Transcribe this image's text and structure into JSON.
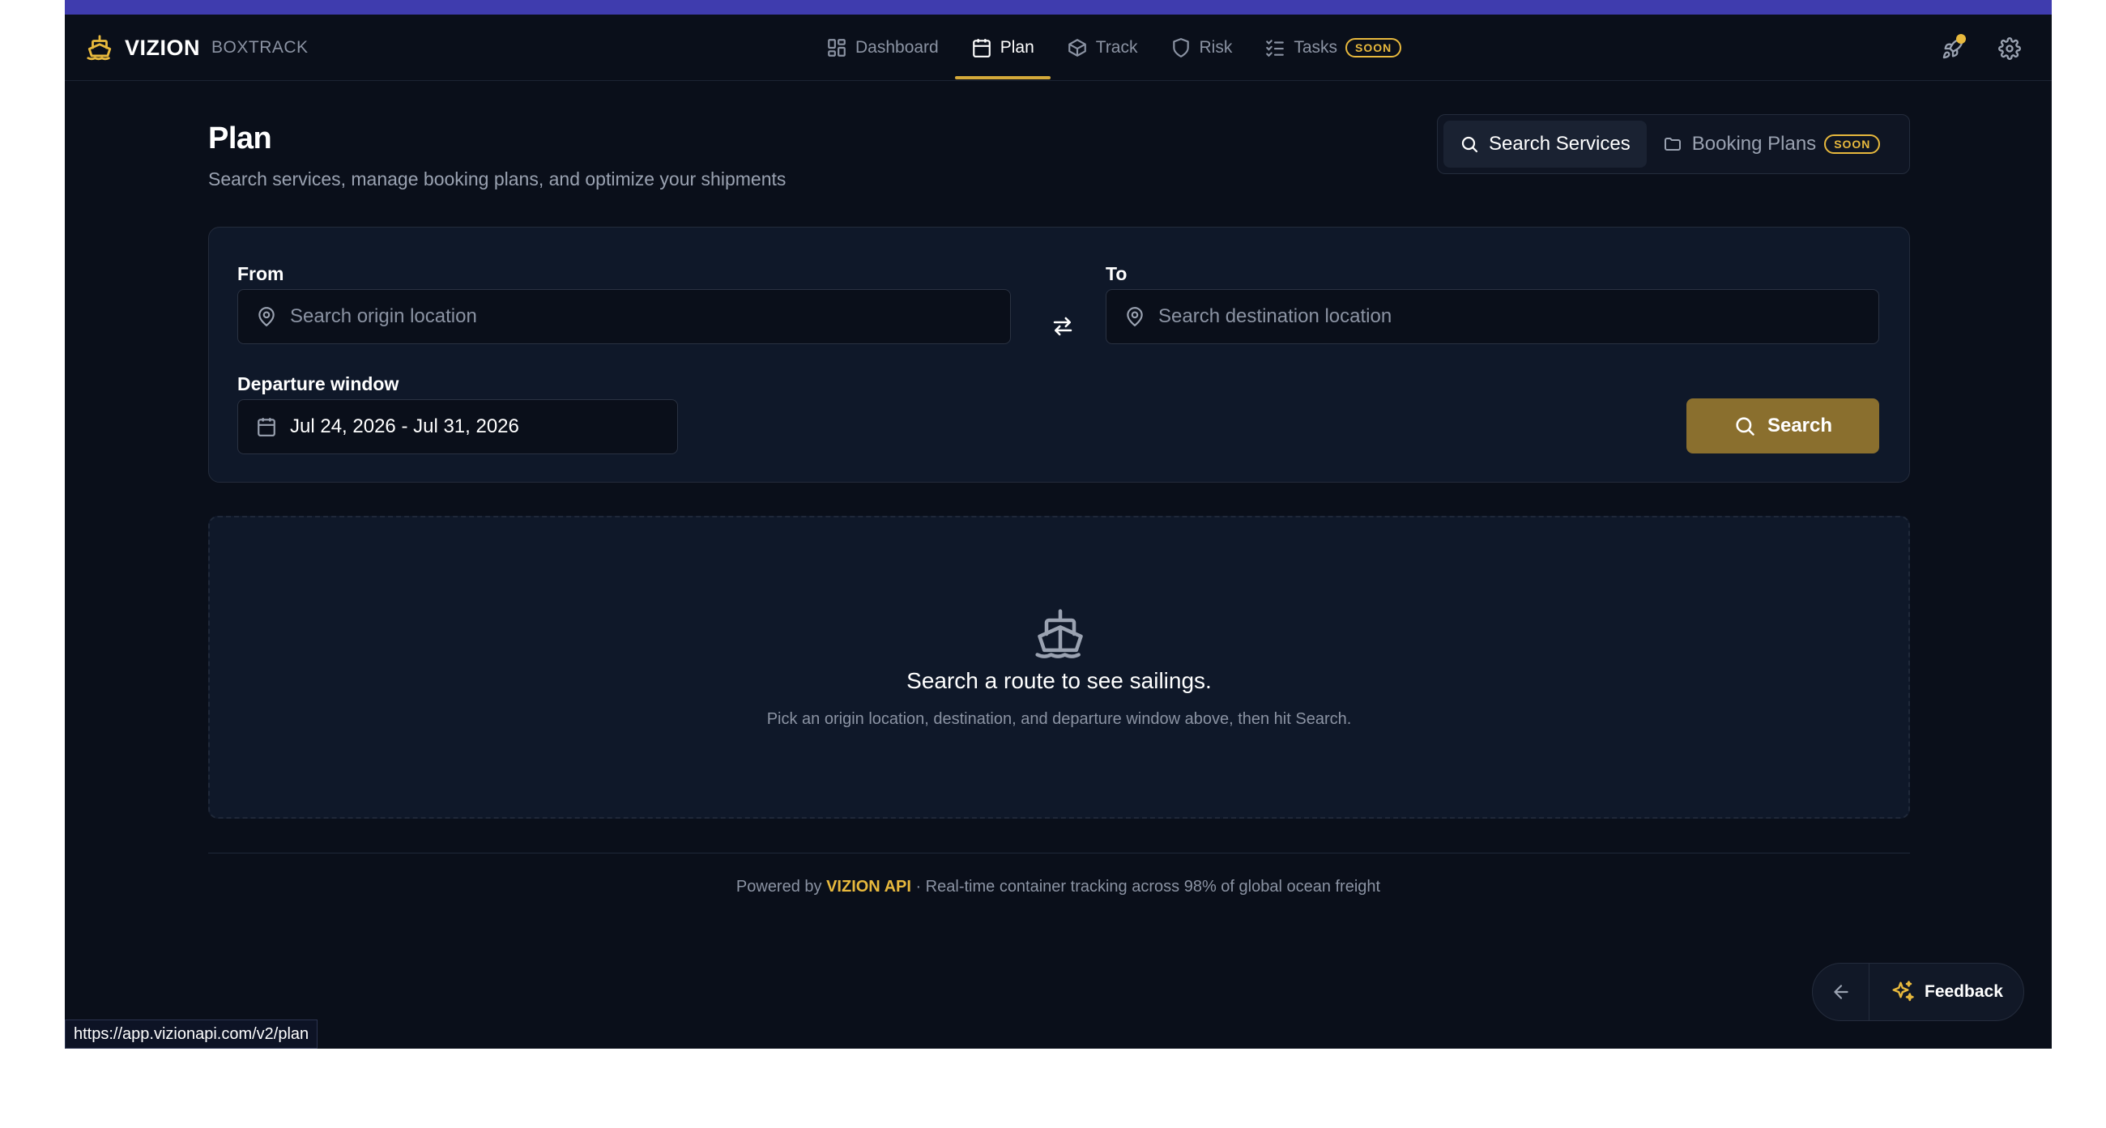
{
  "brand": {
    "name": "VIZION",
    "product": "BOXTRACK"
  },
  "nav": {
    "items": [
      {
        "label": "Dashboard",
        "icon": "dashboard-icon"
      },
      {
        "label": "Plan",
        "icon": "calendar-icon",
        "active": true
      },
      {
        "label": "Track",
        "icon": "box-icon"
      },
      {
        "label": "Risk",
        "icon": "shield-icon"
      },
      {
        "label": "Tasks",
        "icon": "tasks-icon",
        "badge": "SOON"
      }
    ]
  },
  "header_icons": [
    "rocket-icon",
    "gear-icon"
  ],
  "page": {
    "title": "Plan",
    "subtitle": "Search services, manage booking plans, and optimize your shipments"
  },
  "segments": {
    "search_services": "Search Services",
    "booking_plans": "Booking Plans",
    "booking_plans_badge": "SOON"
  },
  "form": {
    "from_label": "From",
    "from_placeholder": "Search origin location",
    "to_label": "To",
    "to_placeholder": "Search destination location",
    "departure_label": "Departure window",
    "departure_value": "Jul 24, 2026 - Jul 31, 2026",
    "search_label": "Search"
  },
  "empty_state": {
    "title": "Search a route to see sailings.",
    "subtitle": "Pick an origin location, destination, and departure window above, then hit Search."
  },
  "footer": {
    "prefix": "Powered by ",
    "api": "VIZION API",
    "suffix": " · Real-time container tracking across 98% of global ocean freight"
  },
  "feedback": {
    "label": "Feedback"
  },
  "status_url": "https://app.vizionapi.com/v2/plan",
  "colors": {
    "accent": "#e8b93d",
    "search_button": "#8a6f2e",
    "background": "#0a0f1a",
    "top_strip": "#3f3cae"
  }
}
